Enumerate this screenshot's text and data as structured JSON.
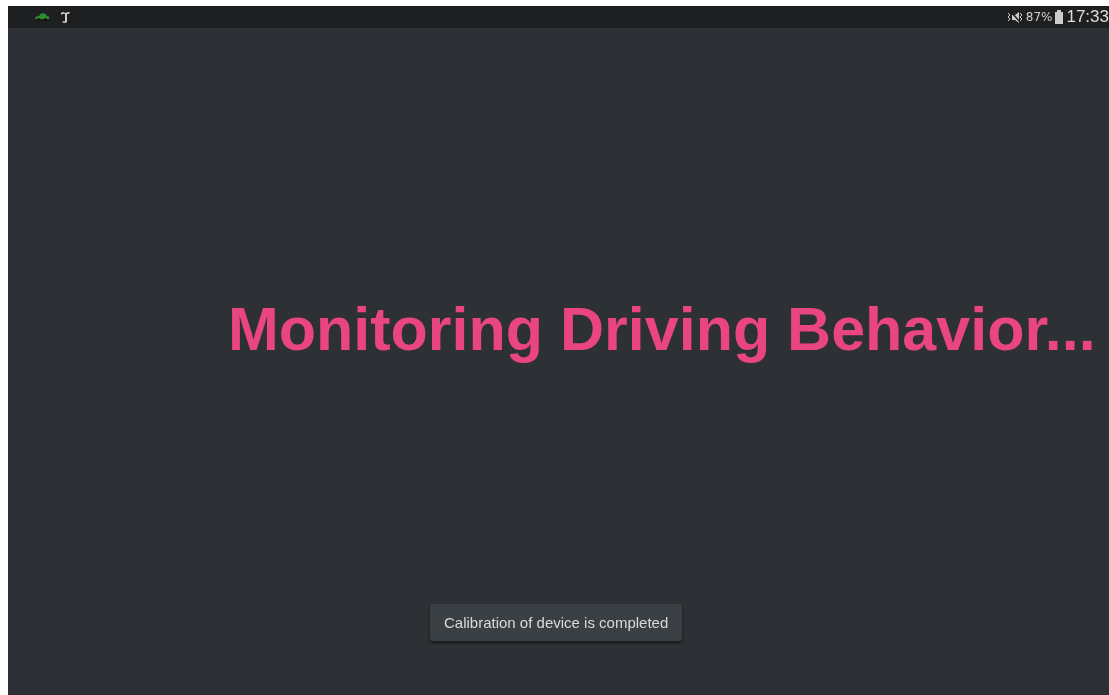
{
  "status_bar": {
    "battery_percent": "87%",
    "time": "17:33"
  },
  "heading": "Monitoring Driving Behavior...",
  "toast": "Calibration of device is completed"
}
